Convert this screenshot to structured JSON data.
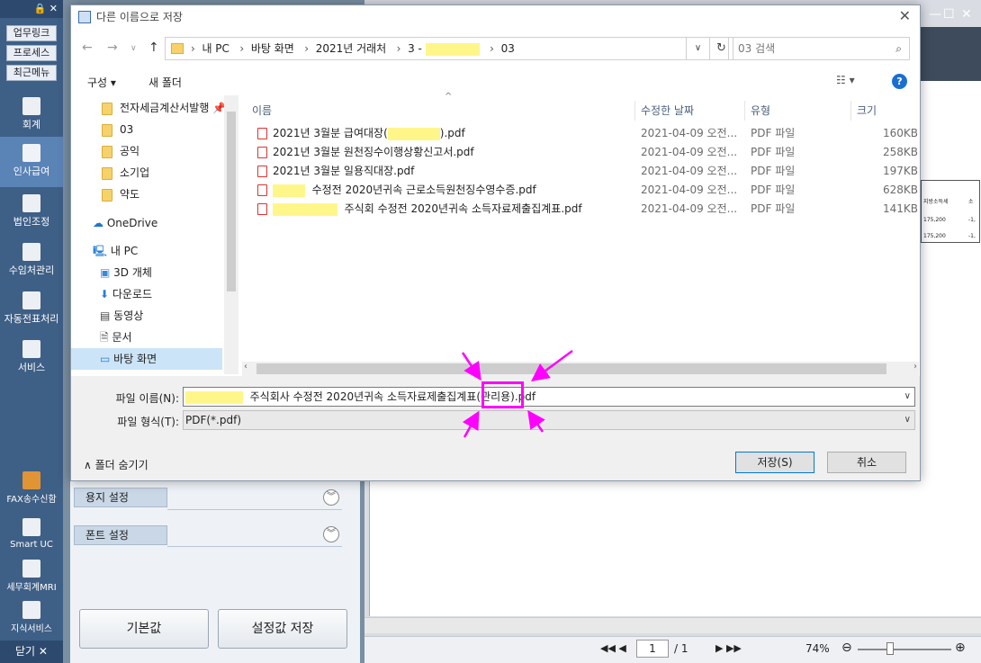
{
  "app": {
    "top_icons": "🔒 ✕",
    "quick_buttons": [
      "업무링크",
      "프로세스",
      "최근메뉴"
    ],
    "nav_items": [
      {
        "label": "회계",
        "icon": "calculator-icon"
      },
      {
        "label": "인사급여",
        "icon": "person-icon",
        "active": true
      },
      {
        "label": "법인조정",
        "icon": "building-icon"
      },
      {
        "label": "수임처관리",
        "icon": "people-icon"
      },
      {
        "label": "자동전표처리",
        "icon": "database-icon"
      },
      {
        "label": "서비스",
        "icon": "monitor-icon"
      }
    ],
    "bottom_items": [
      {
        "label": "FAX송수신함",
        "icon": "fax-icon"
      },
      {
        "label": "Smart UC",
        "icon": "uc-icon"
      },
      {
        "label": "세무회계MRI",
        "icon": "pulse-icon"
      },
      {
        "label": "지식서비스",
        "icon": "book-icon"
      }
    ],
    "close_label": "닫기"
  },
  "settings_panel": {
    "paper_label": "용지 설정",
    "font_label": "폰트 설정",
    "default_button": "기본값",
    "save_settings_button": "설정값 저장"
  },
  "preview": {
    "page_current": "1",
    "page_total": "/ 1",
    "zoom": "74%",
    "table_cells": [
      "지방소득세",
      "소",
      "175,200",
      "-1,",
      "175,200",
      "-1,"
    ]
  },
  "dialog": {
    "title": "다른 이름으로 저장",
    "breadcrumb": [
      "내 PC",
      "바탕 화면",
      "2021년 거래처",
      "3 -",
      "03"
    ],
    "search_placeholder": "03 검색",
    "organize_label": "구성 ▾",
    "new_folder_label": "새 폴더",
    "tree": [
      {
        "label": "전자세금계산서발행",
        "type": "folder",
        "pinned": true
      },
      {
        "label": "03",
        "type": "folder"
      },
      {
        "label": "공익",
        "type": "folder"
      },
      {
        "label": "소기업",
        "type": "folder"
      },
      {
        "label": "약도",
        "type": "folder"
      },
      {
        "label": "OneDrive",
        "type": "cloud"
      },
      {
        "label": "내 PC",
        "type": "pc"
      },
      {
        "label": "3D 개체",
        "type": "cube"
      },
      {
        "label": "다운로드",
        "type": "download"
      },
      {
        "label": "동영상",
        "type": "video"
      },
      {
        "label": "문서",
        "type": "document"
      },
      {
        "label": "바탕 화면",
        "type": "desktop",
        "selected": true
      }
    ],
    "columns": {
      "name": "이름",
      "modified": "수정한 날짜",
      "type": "유형",
      "size": "크기"
    },
    "files": [
      {
        "pre": "2021년 3월분 급여대장(",
        "post": ").pdf",
        "date": "2021-04-09 오전...",
        "type": "PDF 파일",
        "size": "160KB"
      },
      {
        "pre": "2021년 3월분 원천징수이행상황신고서.pdf",
        "post": "",
        "date": "2021-04-09 오전...",
        "type": "PDF 파일",
        "size": "258KB"
      },
      {
        "pre": "2021년 3월분 일용직대장.pdf",
        "post": "",
        "date": "2021-04-09 오전...",
        "type": "PDF 파일",
        "size": "197KB"
      },
      {
        "pre": "",
        "post": "수정전 2020년귀속 근로소득원천징수영수증.pdf",
        "date": "2021-04-09 오전...",
        "type": "PDF 파일",
        "size": "628KB"
      },
      {
        "pre": "",
        "post": "주식회 수정전 2020년귀속 소득자료제출집계표.pdf",
        "date": "2021-04-09 오전...",
        "type": "PDF 파일",
        "size": "141KB"
      }
    ],
    "filename_label": "파일 이름(N):",
    "filename_value": "주식회사 수정전 2020년귀속 소득자료제출집계표(관리용).pdf",
    "filetype_label": "파일 형식(T):",
    "filetype_value": "PDF(*.pdf)",
    "hide_folders_label": "폴더 숨기기",
    "save_button": "저장(S)",
    "cancel_button": "취소"
  },
  "colors": {
    "annotation": "#ff00ff",
    "redaction": "#fff68a",
    "app_nav": "#3e5f86"
  }
}
